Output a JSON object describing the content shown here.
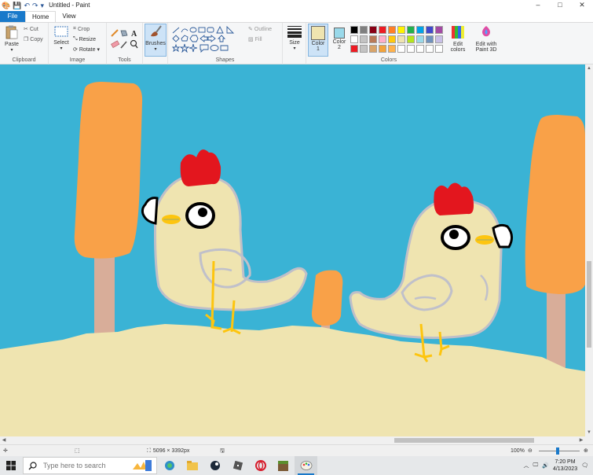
{
  "titlebar": {
    "title": "Untitled - Paint",
    "minimize": "–",
    "maximize": "□",
    "close": "✕"
  },
  "menu": {
    "file": "File",
    "home": "Home",
    "view": "View"
  },
  "ribbon": {
    "clipboard": {
      "paste": "Paste",
      "cut": "Cut",
      "copy": "Copy",
      "label": "Clipboard"
    },
    "image": {
      "select": "Select",
      "crop": "Crop",
      "resize": "Resize",
      "rotate": "Rotate",
      "label": "Image"
    },
    "tools": {
      "label": "Tools"
    },
    "brushes": {
      "label": "Brushes"
    },
    "shapes": {
      "outline": "Outline",
      "fill": "Fill",
      "label": "Shapes"
    },
    "size": {
      "label": "Size"
    },
    "colors": {
      "color1": "Color",
      "color1_num": "1",
      "color2": "Color",
      "color2_num": "2",
      "edit_colors_1": "Edit",
      "edit_colors_2": "colors",
      "paint3d_1": "Edit with",
      "paint3d_2": "Paint 3D",
      "label": "Colors",
      "color1_value": "#efe4b0",
      "color2_value": "#99d9ea",
      "palette": [
        "#000000",
        "#7f7f7f",
        "#880015",
        "#ed1c24",
        "#ff7f27",
        "#fff200",
        "#22b14c",
        "#00a2e8",
        "#3f48cc",
        "#a349a4",
        "#ffffff",
        "#c3c3c3",
        "#b97a57",
        "#ffaec9",
        "#ffc90e",
        "#efe4b0",
        "#b5e61d",
        "#99d9ea",
        "#7092be",
        "#c8bfe7",
        "#ed1c24",
        "#c3c3c3",
        "#d8a46a",
        "#f3a33b",
        "#ffb24c",
        "#ffffff",
        "#ffffff",
        "#ffffff",
        "#ffffff",
        "#ffffff"
      ]
    }
  },
  "status": {
    "dimensions": "5096 × 3392px",
    "zoom": "100%"
  },
  "taskbar": {
    "search_placeholder": "Type here to search",
    "time": "7:20 PM",
    "date": "4/13/2023"
  },
  "colors": {
    "accent": "#1979ca",
    "sky": "#3ab3d5",
    "sand": "#efe4b0",
    "tree": "#f9a148",
    "trunk": "#d8ad99",
    "comb": "#e3161e",
    "beak": "#fdc50f"
  }
}
